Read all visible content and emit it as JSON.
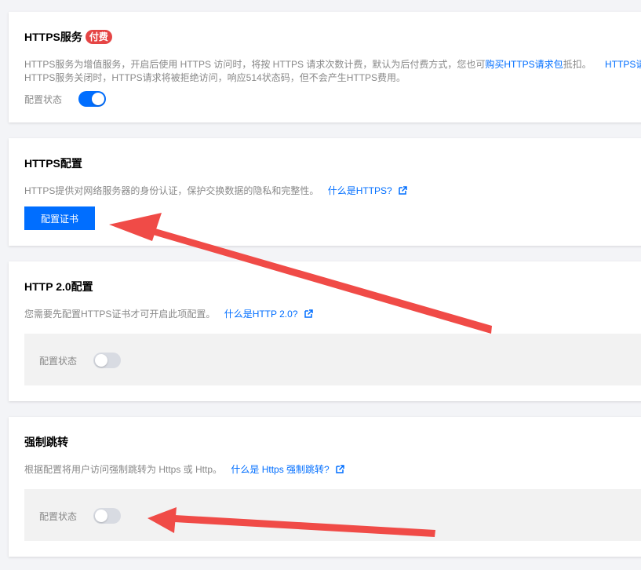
{
  "https_service": {
    "title": "HTTPS服务",
    "badge": "付费",
    "desc_line1_part1": "HTTPS服务为增值服务，开启后使用 HTTPS 访问时，将按 HTTPS 请求次数计费，默认为后付费方式，您也可",
    "desc_line1_link": "购买HTTPS请求包",
    "desc_line1_part2": "抵扣。",
    "desc_line1_link2": "HTTPS请求",
    "desc_line2": "HTTPS服务关闭时，HTTPS请求将被拒绝访问，响应514状态码，但不会产生HTTPS费用。",
    "status_label": "配置状态",
    "status_on": true
  },
  "https_config": {
    "title": "HTTPS配置",
    "desc": "HTTPS提供对网络服务器的身份认证，保护交换数据的隐私和完整性。",
    "link": "什么是HTTPS?",
    "button_label": "配置证书"
  },
  "http2_config": {
    "title": "HTTP 2.0配置",
    "desc": "您需要先配置HTTPS证书才可开启此项配置。",
    "link": "什么是HTTP 2.0?",
    "status_label": "配置状态",
    "status_on": false
  },
  "force_redirect": {
    "title": "强制跳转",
    "desc": "根据配置将用户访问强制跳转为 Https 或 Http。",
    "link": "什么是 Https 强制跳转?",
    "status_label": "配置状态",
    "status_on": false
  },
  "colors": {
    "accent": "#006eff",
    "badge": "#e54545",
    "annotation_arrow": "#f04b47",
    "background": "#f3f4f7"
  }
}
